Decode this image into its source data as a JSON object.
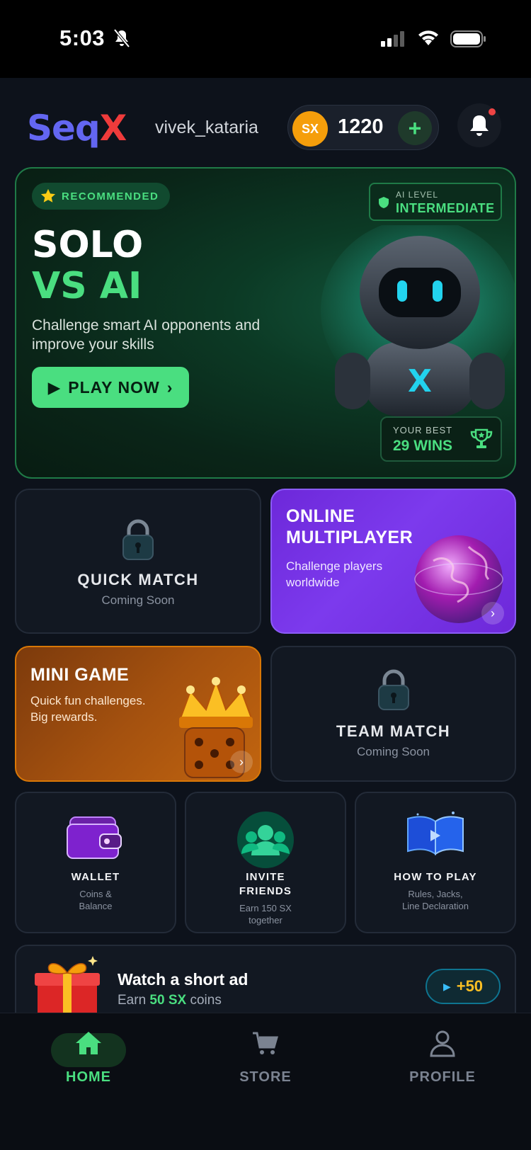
{
  "status": {
    "time": "5:03"
  },
  "header": {
    "logo_left": "Seq",
    "logo_right": "X",
    "username": "vivek_kataria",
    "coin_symbol": "SX",
    "coin_balance": "1220",
    "add_label": "+"
  },
  "hero": {
    "badge": "RECOMMENDED",
    "ai_level_label": "AI LEVEL",
    "ai_level_value": "INTERMEDIATE",
    "title_line1": "SOLO",
    "title_line2": "VS AI",
    "description": "Challenge smart AI opponents and improve your skills",
    "play_label": "PLAY NOW",
    "robot_letter": "X",
    "best_label": "YOUR BEST",
    "best_value": "29 WINS"
  },
  "modes": {
    "quick_match": {
      "title": "QUICK MATCH",
      "sub": "Coming Soon"
    },
    "online_multiplayer": {
      "title_line1": "ONLINE",
      "title_line2": "MULTIPLAYER",
      "desc_line1": "Challenge players",
      "desc_line2": "worldwide"
    },
    "mini_game": {
      "title": "MINI GAME",
      "desc_line1": "Quick fun challenges.",
      "desc_line2": "Big rewards."
    },
    "team_match": {
      "title": "TEAM MATCH",
      "sub": "Coming Soon"
    }
  },
  "shortcuts": {
    "wallet": {
      "title": "WALLET",
      "sub_line1": "Coins &",
      "sub_line2": "Balance"
    },
    "invite": {
      "title_line1": "INVITE",
      "title_line2": "FRIENDS",
      "sub_line1": "Earn 150 SX",
      "sub_line2": "together"
    },
    "howto": {
      "title": "HOW TO PLAY",
      "sub_line1": "Rules, Jacks,",
      "sub_line2": "Line Declaration"
    }
  },
  "ad": {
    "title": "Watch a short ad",
    "sub_prefix": "Earn ",
    "sub_amount": "50 SX",
    "sub_suffix": " coins",
    "reward": "+50"
  },
  "nav": {
    "home": "HOME",
    "store": "STORE",
    "profile": "PROFILE"
  },
  "colors": {
    "accent_green": "#4ade80",
    "brand_indigo": "#6366f1",
    "brand_red": "#ef3b3b",
    "coin_orange": "#f59e0b",
    "purple": "#7c3aed",
    "orange": "#c2650f"
  }
}
